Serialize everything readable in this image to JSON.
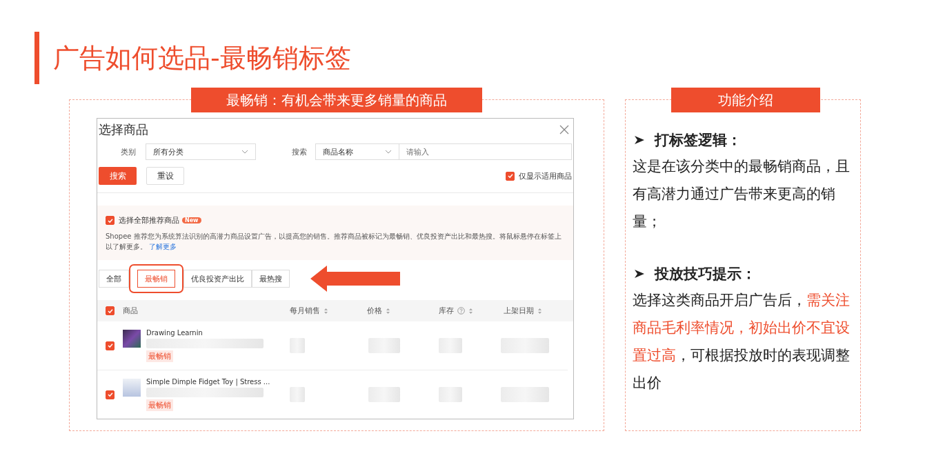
{
  "title": "广告如何选品-最畅销标签",
  "left_panel": {
    "banner": "最畅销：有机会带来更多销量的商品",
    "dialog": {
      "title": "选择商品",
      "category_label": "类别",
      "category_value": "所有分类",
      "search_label": "搜索",
      "search_type": "商品名称",
      "search_placeholder": "请输入",
      "buttons": [
        {
          "label": "搜索",
          "kind": "primary"
        },
        {
          "label": "重设",
          "kind": "secondary"
        }
      ],
      "only_applicable": {
        "label": "仅显示适用商品",
        "checked": true
      },
      "recommend": {
        "label": "选择全部推荐商品",
        "checked": true,
        "badge": "New",
        "description": "Shopee 推荐您为系统算法识别的高潜力商品设置广告，以提高您的销售。推荐商品被标记为最畅销、优良投资产出比和最热搜。将鼠标悬停在标签上以了解更多。",
        "link": "了解更多"
      },
      "tabs": [
        {
          "label": "全部",
          "selected": false
        },
        {
          "label": "最畅销",
          "selected": true
        },
        {
          "label": "优良投资产出比",
          "selected": false
        },
        {
          "label": "最热搜",
          "selected": false
        }
      ],
      "table": {
        "select_all": true,
        "columns": [
          {
            "label": "商品",
            "kind": "plain"
          },
          {
            "label": "每月销售",
            "kind": "sortable"
          },
          {
            "label": "价格",
            "kind": "sortable"
          },
          {
            "label": "库存",
            "kind": "sortable_help"
          },
          {
            "label": "上架日期",
            "kind": "sortable"
          }
        ],
        "rows": [
          {
            "checked": true,
            "name": "Drawing Learnin",
            "tag": "最畅销"
          },
          {
            "checked": true,
            "name": "Simple Dimple Fidget Toy | Stress ...",
            "tag": "最畅销"
          }
        ]
      }
    }
  },
  "right_panel": {
    "banner": "功能介绍",
    "sections": [
      {
        "heading": "打标签逻辑：",
        "parts": [
          {
            "text": "这是在该分类中的最畅销商品，且有高潜力通过广告带来更高的销量；",
            "highlighted": false
          }
        ]
      },
      {
        "heading": "投放技巧提示：",
        "parts": [
          {
            "text": "选择这类商品开启广告后，",
            "highlighted": false
          },
          {
            "text": "需关注商品毛利率情况，初始出价不宜设置过高",
            "highlighted": true
          },
          {
            "text": "，可根据投放时的表现调整出价",
            "highlighted": false
          }
        ]
      }
    ]
  }
}
